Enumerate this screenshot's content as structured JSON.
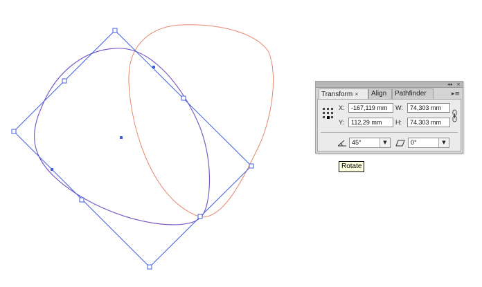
{
  "transform_panel": {
    "tabs": [
      {
        "label": "Transform",
        "active": true
      },
      {
        "label": "Align",
        "active": false
      },
      {
        "label": "Pathfinder",
        "active": false
      }
    ],
    "tab_close_symbol": "×",
    "x_label": "X:",
    "x_value": "-167,119 mm",
    "y_label": "Y:",
    "y_value": "112,29 mm",
    "w_label": "W:",
    "w_value": "74,303 mm",
    "h_label": "H:",
    "h_value": "74,303 mm",
    "rotate_value": "45°",
    "shear_value": "0°",
    "icons": {
      "reference_point": "reference-point-grid-icon",
      "constrain": "chain-link-icon",
      "rotate": "rotate-angle-icon",
      "shear": "shear-icon",
      "panel_menu": "panel-menu-icon"
    }
  },
  "tooltip": {
    "text": "Rotate"
  },
  "colors": {
    "selection": "#3e5ee0",
    "shape_stroke": "#e8866a",
    "panel_bg": "#d4d4d4"
  }
}
